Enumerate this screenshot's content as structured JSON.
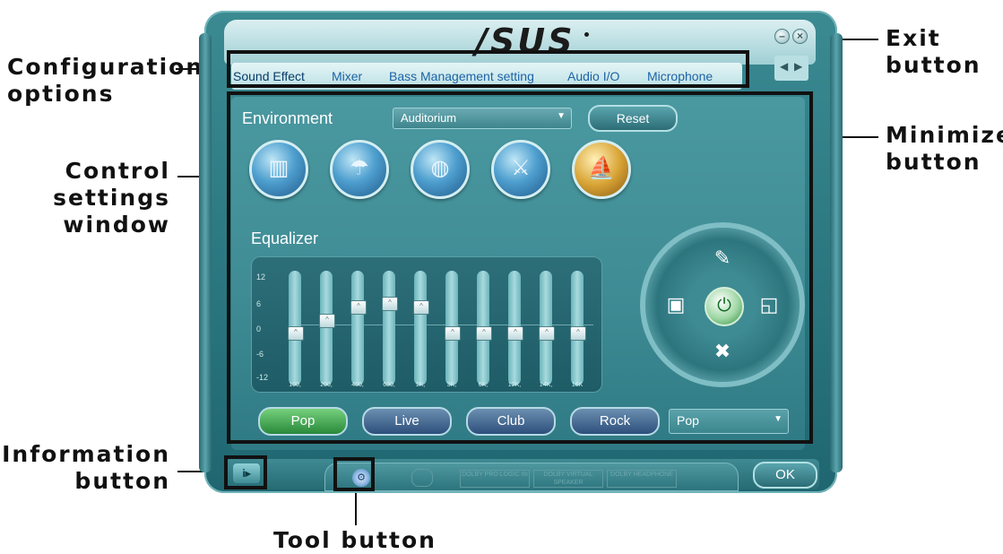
{
  "callouts": {
    "configuration": [
      "Configuration",
      "options"
    ],
    "control": [
      "Control",
      "settings",
      "window"
    ],
    "information": [
      "Information",
      "button"
    ],
    "tool": "Tool button",
    "exit": [
      "Exit",
      "button"
    ],
    "minimize": [
      "Minimize",
      "button"
    ]
  },
  "app": {
    "logo": "/SUS",
    "tabs": [
      "Sound Effect",
      "Mixer",
      "Bass Management setting",
      "Audio I/O",
      "Microphone"
    ],
    "environment": {
      "label": "Environment",
      "selected": "Auditorium",
      "reset_label": "Reset",
      "icons": [
        "padded-cell-icon",
        "shower-icon",
        "stadium-icon",
        "colosseum-icon",
        "opera-house-icon"
      ]
    },
    "equalizer": {
      "label": "Equalizer",
      "scale": [
        "12",
        "6",
        "0",
        "-6",
        "-12"
      ],
      "bands": [
        "100,",
        "200,",
        "400,",
        "600,",
        "1K,",
        "3K,",
        "6K,",
        "12K,",
        "14K,",
        "16K"
      ],
      "gains_db": [
        -1,
        2,
        5,
        6,
        5,
        -1,
        -1,
        -1,
        -1,
        -1
      ],
      "presets": [
        "Pop",
        "Live",
        "Club",
        "Rock"
      ],
      "active_preset": "Pop",
      "preset_select": "Pop"
    },
    "ok_label": "OK",
    "dolby_badges": [
      "DOLBY PRO LOGIC IIx",
      "DOLBY VIRTUAL SPEAKER",
      "DOLBY HEADPHONE"
    ]
  },
  "colors": {
    "frame": "#2f7c85",
    "panel": "#3f8c95",
    "tab_text": "#1d63a6",
    "active_preset": "#28893a",
    "callout_text": "#111111"
  }
}
